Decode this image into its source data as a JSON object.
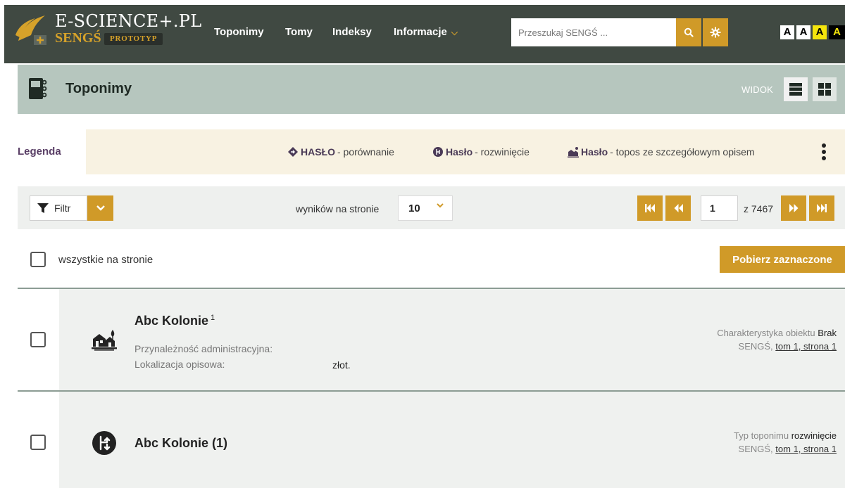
{
  "header": {
    "logo_title": "E-SCIENCE+.PL",
    "logo_sub": "SENGŚ",
    "logo_badge": "PROTOTYP",
    "nav": [
      {
        "label": "Toponimy"
      },
      {
        "label": "Tomy"
      },
      {
        "label": "Indeksy"
      },
      {
        "label": "Informacje"
      }
    ],
    "search_placeholder": "Przeszukaj SENGŚ ...",
    "font_sizes": [
      "A",
      "A",
      "A",
      "A"
    ]
  },
  "page": {
    "title": "Toponimy",
    "view_label": "WIDOK"
  },
  "legend": {
    "label": "Legenda",
    "items": [
      {
        "bold": "HASŁO",
        "text": " - porównanie",
        "icon": "diamond-arrow-icon"
      },
      {
        "bold": "Hasło",
        "text": " - rozwinięcie",
        "icon": "branch-circle-icon"
      },
      {
        "bold": "Hasło",
        "text": " - topos ze szczegółowym opisem",
        "icon": "village-icon"
      }
    ]
  },
  "toolbar": {
    "filter_label": "Filtr",
    "per_page_label": "wyników na stronie",
    "per_page_value": "10",
    "current_page": "1",
    "total_pages": "z 7467"
  },
  "selection": {
    "select_all_label": "wszystkie na stronie",
    "download_label": "Pobierz zaznaczone"
  },
  "results": [
    {
      "title": "Abc Kolonie",
      "sup": "1",
      "icon": "village-icon",
      "fields": [
        {
          "label": "Przynależność administracyjna:",
          "value": ""
        },
        {
          "label": "Lokalizacja opisowa:",
          "value": "złot."
        }
      ],
      "meta_label": "Charakterystyka obiektu",
      "meta_value": "Brak",
      "source": "SENGŚ,",
      "source_link": "tom 1, strona 1"
    },
    {
      "title": "Abc Kolonie (1)",
      "icon": "branch-circle-icon",
      "meta_label": "Typ toponimu",
      "meta_value": "rozwinięcie",
      "source": "SENGŚ,",
      "source_link": "tom 1, strona 1"
    }
  ],
  "colors": {
    "accent": "#d09a28",
    "header_bg": "#404942",
    "title_band": "#b6c6be",
    "legend_bg": "#f8f2e2"
  }
}
